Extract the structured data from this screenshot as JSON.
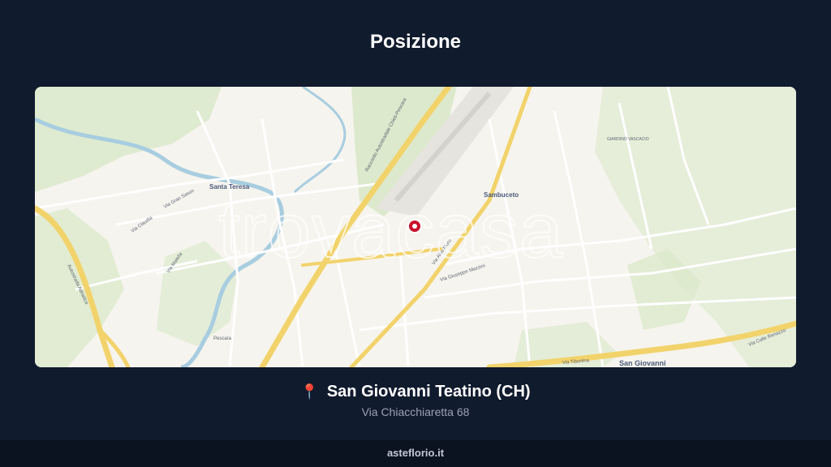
{
  "page": {
    "title": "Posizione"
  },
  "map": {
    "watermark": "trovacasa",
    "places": {
      "santa_teresa": "Santa Teresa",
      "sambuceto": "Sambuceto",
      "san_giovanni": "San Giovanni",
      "giardino_vascacio": "GIARDINO VASCACIO"
    },
    "streets": {
      "via_gran_sasso": "Via Gran Sasso",
      "via_claudia": "Via Claudia",
      "via_maiella": "Via Maiella",
      "raccordo_chieti_pescara": "Raccordo Autostradale Chieti-Pescara",
      "autostrada_adriatica": "Autostrada Adriatica",
      "via_aldo_moro": "Via Aldo Moro",
      "via_giuseppe_mazzini": "Via Giuseppe Mazzini",
      "via_colle_renazzo": "Via Colle Renazzo",
      "via_tiburtina": "Via Tiburtina",
      "pescara": "Pescara"
    },
    "marker_icon": "map-marker-icon"
  },
  "location": {
    "pin_icon": "pushpin-icon",
    "city": "San Giovanni Teatino (CH)",
    "address": "Via Chiacchiaretta 68"
  },
  "footer": {
    "site": "asteflorio.it"
  },
  "colors": {
    "background": "#111b2e",
    "footer": "#0b1220",
    "marker": "#c8102e",
    "road_major": "#f2d36b",
    "river": "#a8cde0",
    "park": "#d7e8c6"
  }
}
